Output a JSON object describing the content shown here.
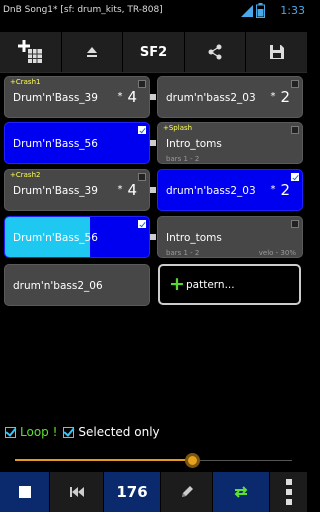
{
  "status_bar": {
    "app_title": "DnB Song1* [sf: drum_kits, TR-808]",
    "time": "1:33"
  },
  "toolbar": {
    "sf_label": "SF2"
  },
  "grid": {
    "row1": {
      "left": {
        "tag": "+Crash1",
        "name": "Drum'n'Bass_39",
        "mult": "4"
      },
      "right": {
        "name": "drum'n'bass2_03",
        "mult": "2"
      }
    },
    "row2": {
      "left": {
        "name": "Drum'n'Bass_56"
      },
      "right": {
        "tag": "+Splash",
        "name": "Intro_toms",
        "sub": "bars 1 - 2"
      }
    },
    "row3": {
      "left": {
        "tag": "+Crash2",
        "name": "Drum'n'Bass_39",
        "mult": "4"
      },
      "right": {
        "name": "drum'n'bass2_03",
        "mult": "2"
      }
    },
    "row4": {
      "left": {
        "name": "Drum'n'Bass_56"
      },
      "right": {
        "name": "Intro_toms",
        "sub": "bars 1 - 2",
        "velo": "velo - 30%"
      }
    },
    "row5": {
      "left": {
        "name": "drum'n'bass2_06"
      },
      "pattern_label": "pattern..."
    },
    "star": "*"
  },
  "options": {
    "loop_label": "Loop !",
    "selected_only_label": "Selected only",
    "loop_checked": true,
    "selected_only_checked": true
  },
  "slider": {
    "position": 0.64
  },
  "bottom_bar": {
    "tempo": "176"
  },
  "colors": {
    "selected_cell": "#0000f0",
    "playing_cell": "#1ec8f0",
    "normal_cell": "#474747",
    "loop_text": "#5be12e",
    "accent": "#e8a01f"
  },
  "icons": [
    "add-pattern-icon",
    "eject-icon",
    "share-icon",
    "save-icon",
    "stop-icon",
    "rewind-icon",
    "edit-pencil-icon",
    "loop-toggle-icon",
    "more-icon"
  ]
}
